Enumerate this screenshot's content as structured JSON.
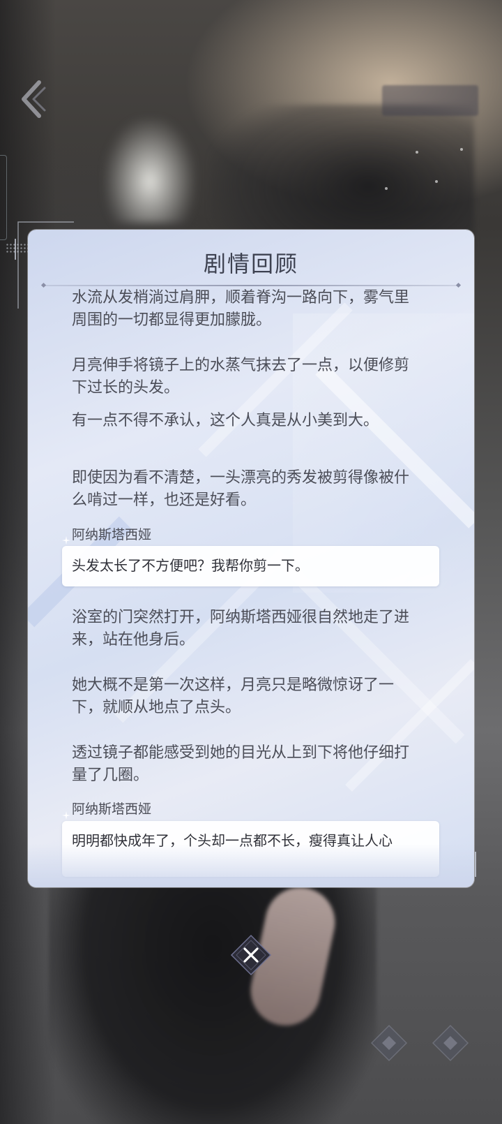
{
  "panel": {
    "title": "剧情回顾"
  },
  "story": [
    {
      "type": "narration",
      "text": "水流从发梢淌过肩胛，顺着脊沟一路向下，雾气里周围的一切都显得更加朦胧。"
    },
    {
      "type": "narration",
      "text": "月亮伸手将镜子上的水蒸气抹去了一点，以便修剪下过长的头发。"
    },
    {
      "type": "narration",
      "text": "有一点不得不承认，这个人真是从小美到大。"
    },
    {
      "type": "narration",
      "text": "即使因为看不清楚，一头漂亮的秀发被剪得像被什么啃过一样，也还是好看。"
    },
    {
      "type": "dialogue",
      "speaker": "阿纳斯塔西娅",
      "text": "头发太长了不方便吧？我帮你剪一下。"
    },
    {
      "type": "narration",
      "text": "浴室的门突然打开，阿纳斯塔西娅很自然地走了进来，站在他身后。"
    },
    {
      "type": "narration",
      "text": "她大概不是第一次这样，月亮只是略微惊讶了一下，就顺从地点了点头。"
    },
    {
      "type": "narration",
      "text": "透过镜子都能感受到她的目光从上到下将他仔细打量了几圈。"
    },
    {
      "type": "dialogue",
      "speaker": "阿纳斯塔西娅",
      "text": "明明都快成年了，个头却一点都不长，瘦得真让人心"
    }
  ],
  "controls": {
    "close_icon": "close-icon",
    "back_icon": "chevron-left-icon"
  },
  "colors": {
    "panel_bg": "#dfe6f5",
    "text": "#4b4d57",
    "title": "#3d4150",
    "bubble_bg": "#ffffff"
  }
}
